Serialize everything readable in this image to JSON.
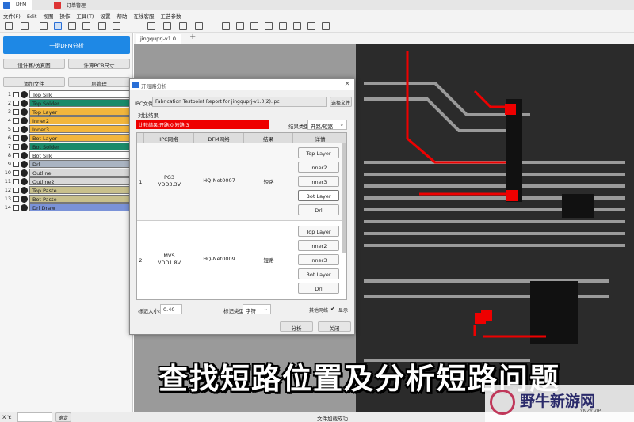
{
  "window": {
    "tabs": [
      "DFM",
      "订单管理"
    ]
  },
  "menu": [
    "文件(F)",
    "Edit",
    "视图",
    "操作",
    "工具(T)",
    "设置",
    "帮助",
    "在线客服",
    "工艺参数"
  ],
  "left": {
    "primary_button": "一键DFM分析",
    "btn_design": "设计赛/仿真图",
    "btn_calc": "计算PCB尺寸",
    "btn_add_file": "添加文件",
    "btn_layer_mgr": "层管理",
    "layers": [
      {
        "n": "1",
        "name": "Top Silk",
        "color": "#ffffff"
      },
      {
        "n": "2",
        "name": "Top Solder",
        "color": "#1a8a6a"
      },
      {
        "n": "3",
        "name": "Top Layer",
        "color": "#f2b63c"
      },
      {
        "n": "4",
        "name": "Inner2",
        "color": "#f2b63c"
      },
      {
        "n": "5",
        "name": "Inner3",
        "color": "#f2b63c"
      },
      {
        "n": "6",
        "name": "Bot Layer",
        "color": "#f2b63c"
      },
      {
        "n": "7",
        "name": "Bot Solder",
        "color": "#1a8a6a"
      },
      {
        "n": "8",
        "name": "Bot Silk",
        "color": "#ffffff"
      },
      {
        "n": "9",
        "name": "Drl",
        "color": "#aab4c2"
      },
      {
        "n": "10",
        "name": "Outline",
        "color": "#d8d8d8"
      },
      {
        "n": "11",
        "name": "Outline2",
        "color": "#d8d8d8"
      },
      {
        "n": "12",
        "name": "Top Paste",
        "color": "#c8c08c"
      },
      {
        "n": "13",
        "name": "Bot Paste",
        "color": "#c8c08c"
      },
      {
        "n": "14",
        "name": "Drl Draw",
        "color": "#7a92d8"
      }
    ]
  },
  "doc_tab": "jingquprj-v1.0",
  "dialog": {
    "title": "开短路分析",
    "ipc_label": "IPC文件",
    "ipc_value": "Fabrication Testpoint Report for jingquprj-v1.0(2).ipc",
    "select_file": "选择文件",
    "compare_label": "对比结果",
    "result_text": "比较结果:开路:0 短路:3",
    "result_type_label": "结果类型",
    "result_type_value": "开路/短路",
    "columns": [
      "IPC网络",
      "DFM网络",
      "结果",
      "详情"
    ],
    "rows": [
      {
        "idx": "1",
        "ipc": "PG3",
        "ipc2": "VDD3.3V",
        "dfm": "HQ-Net0007",
        "result": "短路",
        "details": [
          "Top Layer",
          "Inner2",
          "Inner3",
          "Bot Layer",
          "Drl"
        ]
      },
      {
        "idx": "2",
        "ipc": "MVS",
        "ipc2": "VDD1.8V",
        "dfm": "HQ-Net0009",
        "result": "短路",
        "details": [
          "Top Layer",
          "Inner2",
          "Inner3",
          "Bot Layer",
          "Drl"
        ]
      }
    ],
    "mark_size_label": "标记大小:",
    "mark_size_value": "0.40",
    "mark_type_label": "标记类型",
    "mark_type_value": "字符",
    "other_net_label": "其他网络",
    "show_label": "显示",
    "analyze": "分析",
    "close": "关闭"
  },
  "status": {
    "xy_label": "X Y:",
    "confirm": "确定",
    "message": "文件加载成功"
  },
  "overlay_caption": "查找短路位置及分析短路问题",
  "watermark": {
    "name": "野牛新游网",
    "url": "YNZY.VIP"
  }
}
